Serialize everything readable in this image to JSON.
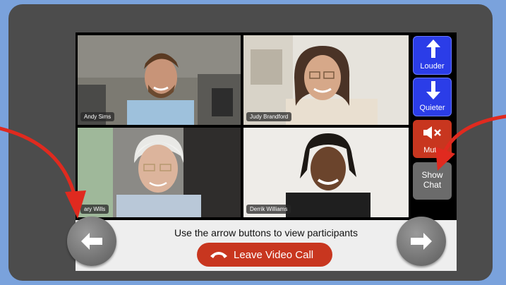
{
  "participants": [
    {
      "name": "Andy Sims"
    },
    {
      "name": "Judy Brandford"
    },
    {
      "name": "ary Wills"
    },
    {
      "name": "Derrik Williams"
    }
  ],
  "controls": {
    "louder_label": "Louder",
    "quieter_label": "Quieter",
    "mute_label": "Mute",
    "show_chat_label": "Show Chat"
  },
  "bottom": {
    "instruction": "Use the arrow buttons to view participants",
    "leave_label": "Leave Video Call"
  },
  "colors": {
    "background": "#7aa2dc",
    "volume_buttons": "#2b3de8",
    "mute_button": "#c8361f",
    "leave_button": "#c8361f",
    "chat_button": "#6b6b6b",
    "annotation_arrows": "#e02a1f"
  },
  "icons": {
    "louder": "arrow-up-icon",
    "quieter": "arrow-down-icon",
    "mute": "speaker-muted-icon",
    "leave": "phone-hangup-icon",
    "previous": "arrow-left-icon",
    "next": "arrow-right-icon"
  }
}
